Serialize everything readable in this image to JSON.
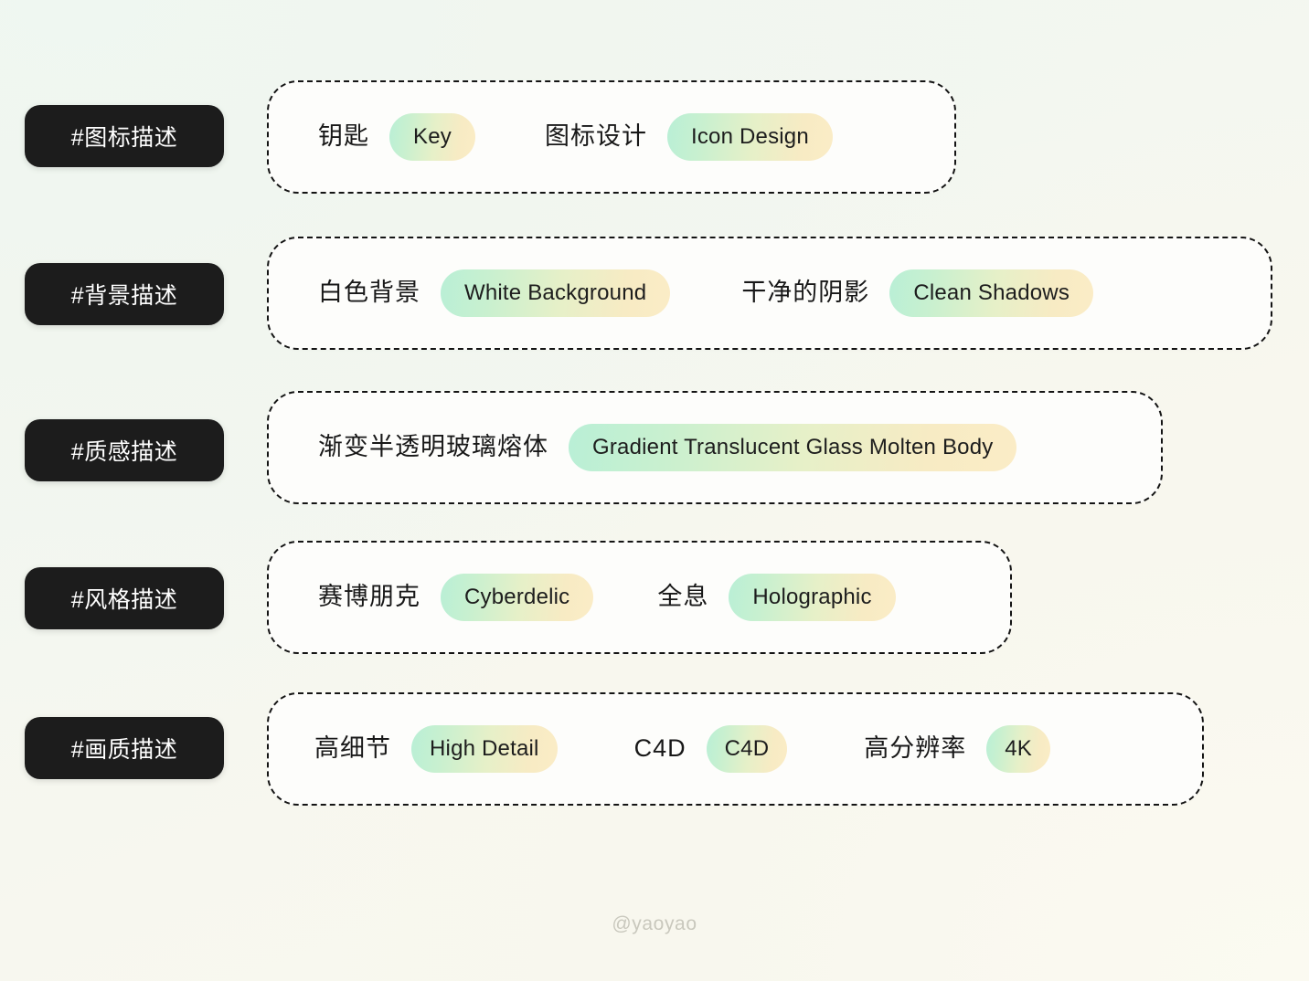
{
  "watermark": "@yaoyao",
  "colors": {
    "chip_bg": "#1c1c1c",
    "chip_text": "#ffffff",
    "panel_bg": "#fdfdfb",
    "panel_border": "#141414",
    "pill_gradient_start": "#b9efd6",
    "pill_gradient_end": "#fbecc6",
    "text_dark": "#181818",
    "watermark_text": "#c9c8bd",
    "page_bg_start": "#f0f7f2",
    "page_bg_end": "#faf9f0"
  },
  "rows": [
    {
      "category": "#图标描述",
      "pairs": [
        {
          "zh": "钥匙",
          "en": "Key"
        },
        {
          "zh": "图标设计",
          "en": "Icon Design"
        }
      ]
    },
    {
      "category": "#背景描述",
      "pairs": [
        {
          "zh": "白色背景",
          "en": "White Background"
        },
        {
          "zh": "干净的阴影",
          "en": "Clean Shadows"
        }
      ]
    },
    {
      "category": "#质感描述",
      "pairs": [
        {
          "zh": "渐变半透明玻璃熔体",
          "en": "Gradient Translucent Glass Molten Body"
        }
      ]
    },
    {
      "category": "#风格描述",
      "pairs": [
        {
          "zh": "赛博朋克",
          "en": "Cyberdelic"
        },
        {
          "zh": "全息",
          "en": "Holographic"
        }
      ]
    },
    {
      "category": "#画质描述",
      "pairs": [
        {
          "zh": "高细节",
          "en": "High Detail"
        },
        {
          "zh": "C4D",
          "en": "C4D"
        },
        {
          "zh": "高分辨率",
          "en": "4K"
        }
      ]
    }
  ]
}
